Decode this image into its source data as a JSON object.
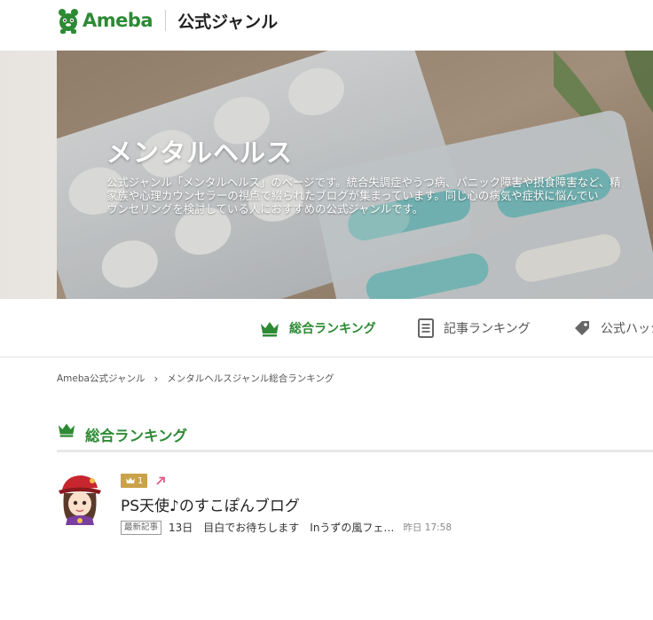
{
  "header": {
    "brand": "Ameba",
    "section": "公式ジャンル"
  },
  "hero": {
    "title": "メンタルヘルス",
    "description_lines": [
      "公式ジャンル「メンタルヘルス」のページです。統合失調症やうつ病、パニック障害や摂食障害など、精",
      "家族や心理カウンセラーの視点で綴られたブログが集まっています。同じ心の病気や症状に悩んでい",
      "ウンセリングを検討している人におすすめの公式ジャンルです。"
    ]
  },
  "tabs": [
    {
      "label": "総合ランキング",
      "icon": "crown-icon",
      "active": true
    },
    {
      "label": "記事ランキング",
      "icon": "document-icon",
      "active": false
    },
    {
      "label": "公式ハッシ",
      "icon": "tag-icon",
      "active": false
    }
  ],
  "breadcrumb": {
    "items": [
      "Ameba公式ジャンル",
      "メンタルヘルスジャンル総合ランキング"
    ],
    "separator": "›"
  },
  "section": {
    "title": "総合ランキング",
    "icon": "crown-icon"
  },
  "ranking": [
    {
      "rank": "1",
      "trend": "up",
      "blog_title": "PS天使♪のすこぽんブログ",
      "entry_tag": "最新記事",
      "entry_title": "13日　目白でお待ちします　Inうずの風フェ…",
      "entry_time": "昨日 17:58"
    }
  ],
  "colors": {
    "brand_green": "#2d8a34",
    "badge_gold": "#c9a24a",
    "trend_pink": "#e05a8a"
  }
}
